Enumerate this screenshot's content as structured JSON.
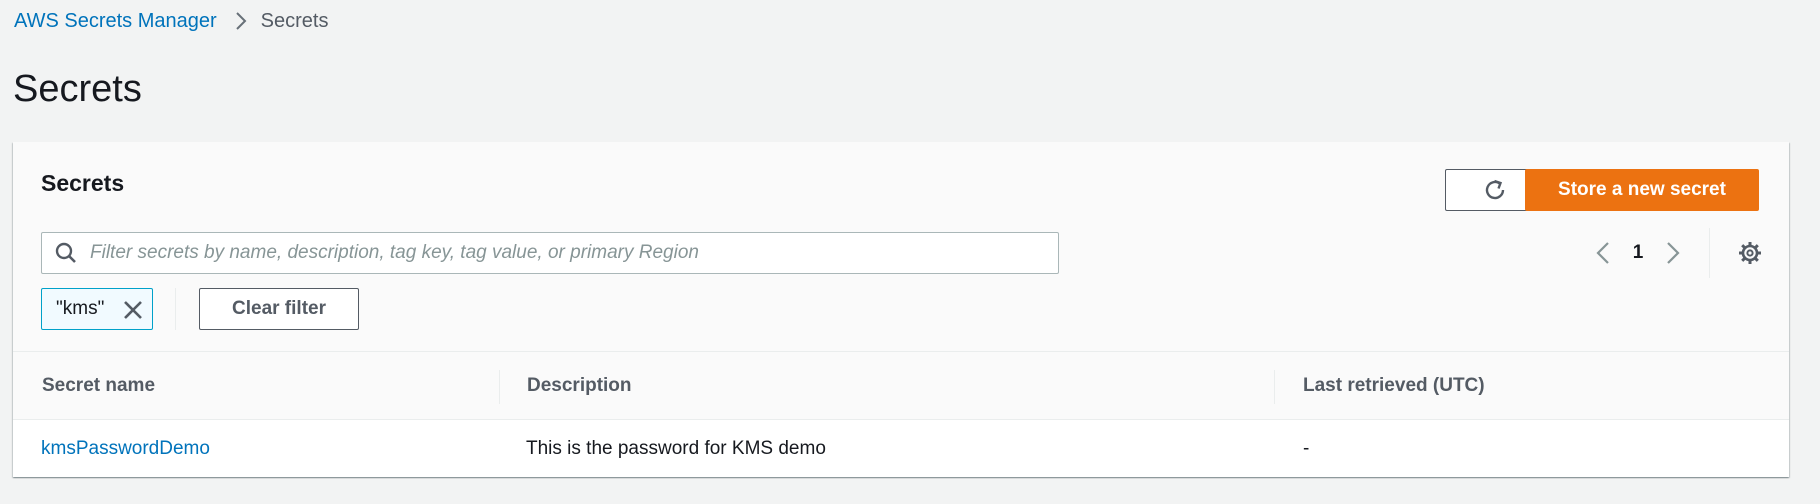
{
  "breadcrumb": {
    "items": [
      {
        "label": "AWS Secrets Manager"
      },
      {
        "label": "Secrets"
      }
    ]
  },
  "page": {
    "title": "Secrets"
  },
  "panel": {
    "title": "Secrets",
    "store_button_label": "Store a new secret",
    "search": {
      "placeholder": "Filter secrets by name, description, tag key, tag value, or primary Region",
      "value": ""
    },
    "pagination": {
      "current_page": "1"
    },
    "filter_token": {
      "label": "\"kms\""
    },
    "clear_filter_label": "Clear filter"
  },
  "table": {
    "columns": [
      "Secret name",
      "Description",
      "Last retrieved (UTC)"
    ],
    "rows": [
      {
        "name": "kmsPasswordDemo",
        "description": "This is the password for KMS demo",
        "last_retrieved": "-"
      }
    ]
  },
  "colors": {
    "primary_button": "#ec7211",
    "link": "#0073bb",
    "background": "#f2f3f3",
    "token_border": "#00a1c9"
  },
  "icons": {
    "breadcrumb_separator": "chevron-right-icon",
    "refresh": "refresh-icon",
    "search": "search-icon",
    "prev_page": "chevron-left-icon",
    "next_page": "chevron-right-icon",
    "settings": "gear-icon",
    "token_remove": "close-icon"
  }
}
